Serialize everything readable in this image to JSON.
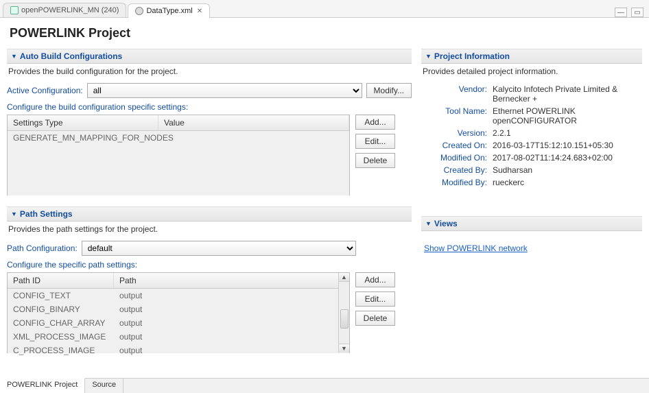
{
  "tabs": [
    {
      "label": "openPOWERLINK_MN (240)",
      "active": false
    },
    {
      "label": "DataType.xml",
      "active": true
    }
  ],
  "page_title": "POWERLINK Project",
  "auto_build": {
    "header": "Auto Build Configurations",
    "desc": "Provides the build configuration for the project.",
    "active_label": "Active Configuration:",
    "active_value": "all",
    "modify_btn": "Modify...",
    "sub_label": "Configure the build configuration specific settings:",
    "col_settings": "Settings Type",
    "col_value": "Value",
    "rows": [
      {
        "type": "GENERATE_MN_MAPPING_FOR_NODES",
        "value": ""
      }
    ],
    "add_btn": "Add...",
    "edit_btn": "Edit...",
    "delete_btn": "Delete"
  },
  "path_settings": {
    "header": "Path Settings",
    "desc": "Provides the path settings for the project.",
    "config_label": "Path Configuration:",
    "config_value": "default",
    "sub_label": "Configure the specific path settings:",
    "col_id": "Path ID",
    "col_path": "Path",
    "rows": [
      {
        "id": "CONFIG_TEXT",
        "path": "output"
      },
      {
        "id": "CONFIG_BINARY",
        "path": "output"
      },
      {
        "id": "CONFIG_CHAR_ARRAY",
        "path": "output"
      },
      {
        "id": "XML_PROCESS_IMAGE",
        "path": "output"
      },
      {
        "id": "C_PROCESS_IMAGE",
        "path": "output"
      }
    ],
    "add_btn": "Add...",
    "edit_btn": "Edit...",
    "delete_btn": "Delete"
  },
  "project_info": {
    "header": "Project Information",
    "desc": "Provides detailed project information.",
    "labels": {
      "vendor": "Vendor:",
      "tool": "Tool Name:",
      "version": "Version:",
      "created_on": "Created On:",
      "modified_on": "Modified On:",
      "created_by": "Created By:",
      "modified_by": "Modified By:"
    },
    "values": {
      "vendor": "Kalycito Infotech Private Limited & Bernecker +",
      "tool": "Ethernet POWERLINK openCONFIGURATOR",
      "version": "2.2.1",
      "created_on": "2016-03-17T15:12:10.151+05:30",
      "modified_on": "2017-08-02T11:14:24.683+02:00",
      "created_by": "Sudharsan",
      "modified_by": "rueckerc"
    }
  },
  "views": {
    "header": "Views",
    "link": "Show POWERLINK network"
  },
  "bottom_tabs": {
    "project": "POWERLINK Project",
    "source": "Source"
  }
}
